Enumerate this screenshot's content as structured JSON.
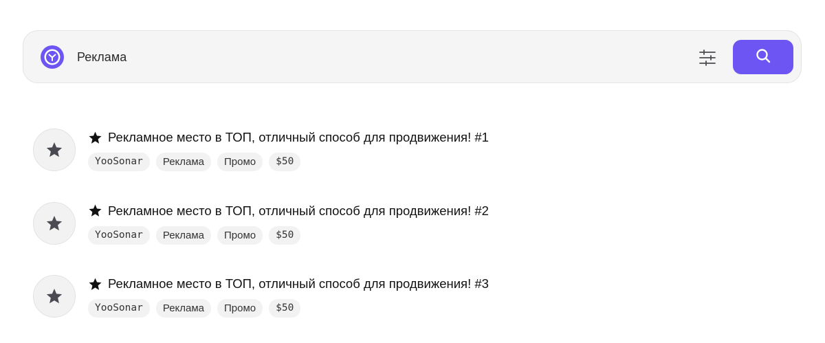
{
  "search": {
    "value": "Реклама",
    "accent_color": "#6c55f2",
    "logo_icon": "brand-logo-icon",
    "filter_icon": "sliders-icon",
    "submit_icon": "search-icon"
  },
  "results": [
    {
      "title": "Рекламное место в ТОП, отличный способ для продвижения! #1",
      "icon": "star-icon",
      "tags": [
        "YooSonar",
        "Реклама",
        "Промо",
        "$50"
      ]
    },
    {
      "title": "Рекламное место в ТОП, отличный способ для продвижения! #2",
      "icon": "star-icon",
      "tags": [
        "YooSonar",
        "Реклама",
        "Промо",
        "$50"
      ]
    },
    {
      "title": "Рекламное место в ТОП, отличный способ для продвижения! #3",
      "icon": "star-icon",
      "tags": [
        "YooSonar",
        "Реклама",
        "Промо",
        "$50"
      ]
    }
  ]
}
